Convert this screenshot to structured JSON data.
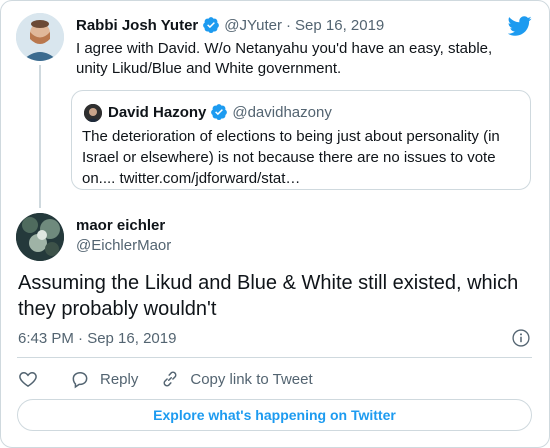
{
  "parent_tweet": {
    "author_name": "Rabbi Josh Yuter",
    "author_handle": "@JYuter",
    "separator": "·",
    "date": "Sep 16, 2019",
    "text": "I agree with David. W/o Netanyahu you'd have an easy, stable, unity Likud/Blue and White government."
  },
  "quoted_tweet": {
    "author_name": "David Hazony",
    "author_handle": "@davidhazony",
    "text": "The deterioration of elections to being just about personality (in Israel or elsewhere) is not because there are no issues to vote on.... twitter.com/jdforward/stat…"
  },
  "main_tweet": {
    "author_name": "maor eichler",
    "author_handle": "@EichlerMaor",
    "text": "Assuming the Likud and Blue & White still existed, which they probably wouldn't",
    "timestamp": "6:43 PM · Sep 16, 2019"
  },
  "actions": {
    "reply_label": "Reply",
    "copy_link_label": "Copy link to Tweet"
  },
  "explore_label": "Explore what's happening on Twitter",
  "colors": {
    "accent": "#1d9bf0",
    "text_primary": "#0f1419",
    "text_secondary": "#536471",
    "border": "#cfd9de"
  },
  "icons": [
    "twitter-bird-icon",
    "verified-badge-icon",
    "info-icon",
    "heart-icon",
    "reply-icon",
    "link-icon"
  ]
}
